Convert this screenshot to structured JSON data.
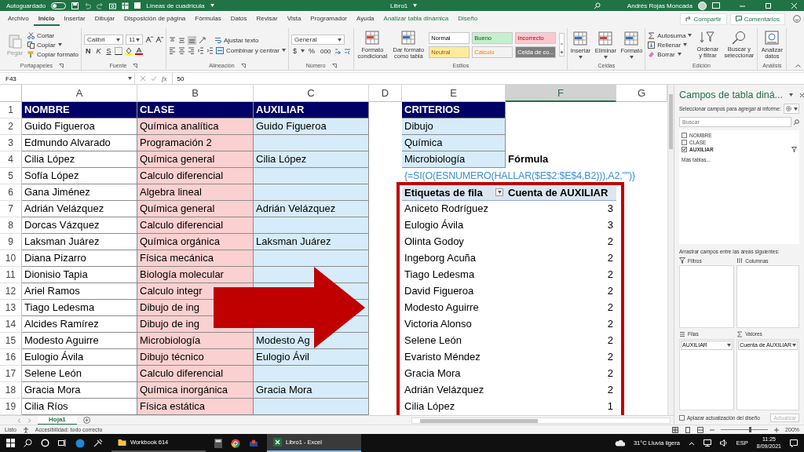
{
  "title_bar": {
    "autosave": "Autoguardado",
    "autosave_on": false,
    "gridlines": "Líneas de cuadrícula",
    "gridlines_checked": false,
    "document": "Libro1",
    "user": "Andrés Rojas Moncada"
  },
  "tabs": [
    {
      "label": "Archivo",
      "selected": false,
      "kind": "standard"
    },
    {
      "label": "Inicio",
      "selected": true,
      "kind": "standard"
    },
    {
      "label": "Insertar",
      "selected": false,
      "kind": "standard"
    },
    {
      "label": "Dibujar",
      "selected": false,
      "kind": "standard"
    },
    {
      "label": "Disposición de página",
      "selected": false,
      "kind": "standard"
    },
    {
      "label": "Fórmulas",
      "selected": false,
      "kind": "standard"
    },
    {
      "label": "Datos",
      "selected": false,
      "kind": "standard"
    },
    {
      "label": "Revisar",
      "selected": false,
      "kind": "standard"
    },
    {
      "label": "Vista",
      "selected": false,
      "kind": "standard"
    },
    {
      "label": "Programador",
      "selected": false,
      "kind": "standard"
    },
    {
      "label": "Ayuda",
      "selected": false,
      "kind": "standard"
    },
    {
      "label": "Analizar tabla dinámica",
      "selected": false,
      "kind": "contextual"
    },
    {
      "label": "Diseño",
      "selected": false,
      "kind": "contextual"
    }
  ],
  "share": "Compartir",
  "comments": "Comentarios",
  "ribbon": {
    "clipboard": {
      "paste": "Pegar",
      "cut": "Cortar",
      "copy": "Copiar",
      "painter": "Copiar formato",
      "label": "Portapapeles"
    },
    "font": {
      "name": "Calibri",
      "size": "11",
      "bold": "N",
      "italic": "K",
      "underline": "S",
      "label": "Fuente"
    },
    "alignment": {
      "wrap": "Ajustar texto",
      "merge": "Combinar y centrar",
      "label": "Alineación"
    },
    "number": {
      "format": "General",
      "currency": "$",
      "percent": "%",
      "thousands": "000",
      "label": "Número"
    },
    "styles": {
      "conditional": "Formato condicional",
      "as_table": "Dar formato como tabla",
      "cells": [
        {
          "label": "Normal",
          "color": "#ffffff"
        },
        {
          "label": "Bueno",
          "color": "#c6efce"
        },
        {
          "label": "Incorrecto",
          "color": "#ffc7ce"
        },
        {
          "label": "Neutral",
          "color": "#ffeb9c"
        },
        {
          "label": "Cálculo",
          "color": "#f2f2f2"
        },
        {
          "label": "Celda de co...",
          "color": "#7f7f7f"
        }
      ],
      "label": "Estilos"
    },
    "cells": {
      "insert": "Insertar",
      "delete": "Eliminar",
      "format": "Formato",
      "label": "Celdas"
    },
    "editing": {
      "autosum": "Autosuma",
      "fill": "Rellenar",
      "clear": "Borrar",
      "sort": "Ordenar y filtrar",
      "find": "Buscar y seleccionar",
      "label": "Edición"
    },
    "analysis": {
      "analyze": "Analizar datos",
      "label": "Análisis"
    }
  },
  "formula_bar": {
    "cell": "F43",
    "fx": "fx",
    "value": "50"
  },
  "sheet": {
    "columns": [
      {
        "label": "A",
        "selected": false
      },
      {
        "label": "B",
        "selected": false
      },
      {
        "label": "C",
        "selected": false
      },
      {
        "label": "D",
        "selected": false
      },
      {
        "label": "E",
        "selected": false
      },
      {
        "label": "F",
        "selected": true
      },
      {
        "label": "G",
        "selected": false
      }
    ],
    "row_numbers": [
      "1",
      "2",
      "3",
      "4",
      "5",
      "6",
      "7",
      "8",
      "9",
      "10",
      "11",
      "12",
      "13",
      "14",
      "15",
      "16",
      "17",
      "18",
      "19"
    ],
    "source_table": {
      "headers": [
        "NOMBRE",
        "CLASE",
        "AUXILIAR"
      ],
      "rows": [
        {
          "name": "Guido Figueroa",
          "class": "Química analítica",
          "aux": "Guido Figueroa"
        },
        {
          "name": "Edmundo Alvarado",
          "class": "Programación 2"
        },
        {
          "name": "Cilia López",
          "class": "Química general",
          "aux": "Cilia López"
        },
        {
          "name": "Sofía López",
          "class": "Calculo diferencial"
        },
        {
          "name": "Gana Jiménez",
          "class": "Algebra lineal"
        },
        {
          "name": "Adrián Velázquez",
          "class": "Química general",
          "aux": "Adrián Velázquez"
        },
        {
          "name": "Dorcas Vázquez",
          "class": "Calculo diferencial"
        },
        {
          "name": "Laksman Juárez",
          "class": "Química orgánica",
          "aux": "Laksman Juárez"
        },
        {
          "name": "Diana Pizarro",
          "class": "Física mecánica"
        },
        {
          "name": "Dionisio Tapia",
          "class": "Biología molecular"
        },
        {
          "name": "Ariel Ramos",
          "class": "Calculo integr"
        },
        {
          "name": "Tiago Ledesma",
          "class": "Dibujo de ing"
        },
        {
          "name": "Alcides Ramírez",
          "class": "Dibujo de ing"
        },
        {
          "name": "Modesto Aguirre",
          "class": "Microbiología",
          "aux": "Modesto Ag"
        },
        {
          "name": "Eulogio Ávila",
          "class": "Dibujo técnico",
          "aux": "Eulogio Ávil"
        },
        {
          "name": "Selene León",
          "class": "Calculo diferencial"
        },
        {
          "name": "Gracia Mora",
          "class": "Química inorgánica",
          "aux": "Gracia Mora"
        },
        {
          "name": "Cilia Ríos",
          "class": "Física estática"
        }
      ]
    },
    "criteria": {
      "header": "CRITERIOS",
      "items": [
        "Dibujo",
        "Química",
        "Microbiología"
      ]
    },
    "formula_label": "Fórmula",
    "formula": "{=SI(O(ESNUMERO(HALLAR($E$2:$E$4,B2))),A2,\"\")}",
    "pivot": {
      "headers": [
        "Etiquetas de fila",
        "Cuenta de AUXILIAR"
      ],
      "rows": [
        [
          "Aniceto Rodríguez",
          "3"
        ],
        [
          "Eulogio Ávila",
          "3"
        ],
        [
          "Olinta Godoy",
          "2"
        ],
        [
          "Ingeborg Acuña",
          "2"
        ],
        [
          "Tiago Ledesma",
          "2"
        ],
        [
          "David Figueroa",
          "2"
        ],
        [
          "Modesto Aguirre",
          "2"
        ],
        [
          "Victoria Alonso",
          "2"
        ],
        [
          "Selene León",
          "2"
        ],
        [
          "Evaristo Méndez",
          "2"
        ],
        [
          "Gracia Mora",
          "2"
        ],
        [
          "Adrián Velázquez",
          "2"
        ],
        [
          "Cilia López",
          "1"
        ]
      ]
    }
  },
  "sheet_tabs": [
    {
      "label": "Hoja1",
      "selected": true
    }
  ],
  "pane": {
    "title": "Campos de tabla diná...",
    "instructions": "Seleccionar campos para agregar al informe:",
    "search_placeholder": "Buscar",
    "fields": [
      {
        "label": "NOMBRE",
        "checked": false
      },
      {
        "label": "CLASE",
        "checked": false
      },
      {
        "label": "AUXILIAR",
        "checked": true
      }
    ],
    "more_tables": "Más tablas...",
    "areas_hint": "Arrastrar campos entre las áreas siguientes:",
    "areas": [
      {
        "title": "Filtros"
      },
      {
        "title": "Columnas"
      },
      {
        "title": "Filas",
        "items": [
          "AUXILIAR"
        ]
      },
      {
        "title": "Valores",
        "items": [
          "Cuenta de AUXILIAR"
        ]
      }
    ],
    "defer_label": "Aplazar actualización del diseño",
    "defer_checked": false,
    "update_button": "Actualizar",
    "update_disabled": true
  },
  "status_bar": {
    "state": "Listo",
    "accessibility": "Accesibilidad: todo correcto",
    "zoom_slider": {
      "level": 0.62
    },
    "zoom": "200%"
  },
  "taskbar": {
    "apps": [
      {
        "label": "Workbook 614",
        "active": false
      },
      {
        "label": "Libro1 - Excel",
        "active": true
      }
    ],
    "weather": "31°C Lluvia ligera",
    "language": "ESP",
    "time": "11:25",
    "date": "8/09/2021"
  }
}
